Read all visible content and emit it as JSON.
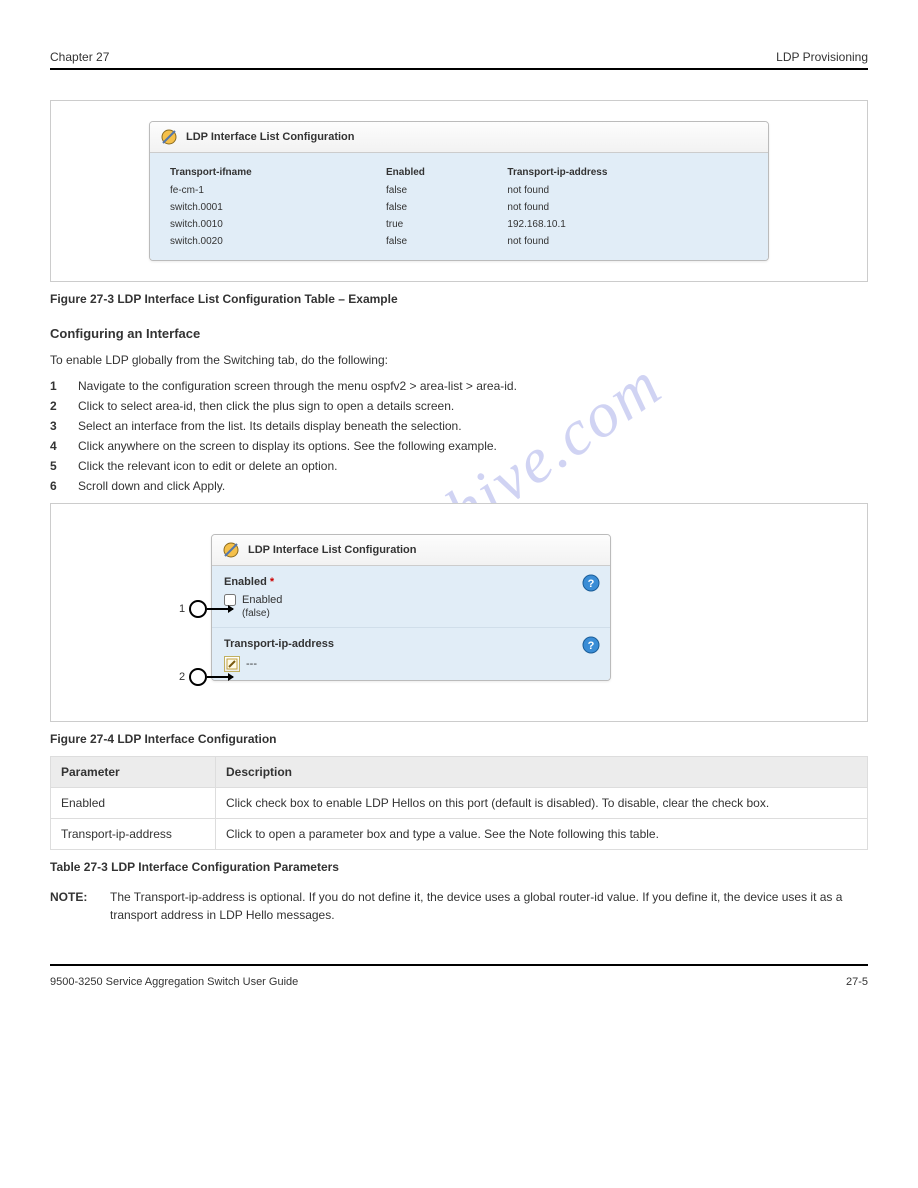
{
  "header": {
    "doc_title": "LDP Provisioning",
    "chapter": "Chapter 27"
  },
  "panel1": {
    "title": "LDP Interface List Configuration",
    "columns": [
      "Transport-ifname",
      "Enabled",
      "Transport-ip-address"
    ],
    "rows": [
      {
        "name": "fe-cm-1",
        "enabled": "false",
        "addr": "not found"
      },
      {
        "name": "switch.0001",
        "enabled": "false",
        "addr": "not found"
      },
      {
        "name": "switch.0010",
        "enabled": "true",
        "addr": "192.168.10.1"
      },
      {
        "name": "switch.0020",
        "enabled": "false",
        "addr": "not found"
      }
    ]
  },
  "figure1_caption": "Figure 27-3  LDP Interface List Configuration Table – Example",
  "intro_text": "To enable LDP globally from the Switching tab, do the following:",
  "steps": [
    {
      "n": "1",
      "t": "Navigate to the configuration screen through the menu ospfv2 > area-list > area-id."
    },
    {
      "n": "2",
      "t": "Click to select area-id, then click the plus sign to open a details screen."
    },
    {
      "n": "3",
      "t": "Select an interface from the list. Its details display beneath the selection."
    },
    {
      "n": "4",
      "t": "Click anywhere on the screen to display its options. See the following example."
    },
    {
      "n": "5",
      "t": "Click the relevant icon to edit or delete an option."
    },
    {
      "n": "6",
      "t": "Scroll down and click Apply."
    }
  ],
  "panel2": {
    "title": "LDP Interface List Configuration",
    "field1_label": "Enabled",
    "field1_checkbox_label": "Enabled",
    "field1_value": "(false)",
    "field2_label": "Transport-ip-address",
    "field2_value": "---"
  },
  "figure2_caption": "Figure 27-4  LDP Interface Configuration",
  "table": {
    "caption": "Table 27-3  LDP Interface Configuration Parameters",
    "headers": [
      "Parameter",
      "Description"
    ],
    "rows": [
      {
        "param": "Enabled",
        "desc": "Click check box to enable LDP Hellos on this port (default is disabled). To disable, clear the check box."
      },
      {
        "param": "Transport-ip-address",
        "desc": "Click to open a parameter box and type a value. See the Note following this table."
      }
    ]
  },
  "note": {
    "label": "NOTE:",
    "text": "The Transport-ip-address is optional. If you do not define it, the device uses a global router-id value. If you define it, the device uses it as a transport address in LDP Hello messages."
  },
  "footer": {
    "left": "9500-3250 Service Aggregation Switch User Guide",
    "right": "27-5"
  },
  "watermark": "manualshive.com"
}
